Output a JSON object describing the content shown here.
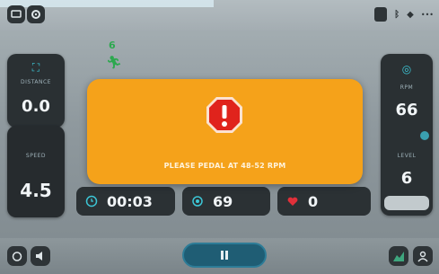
{
  "left_panel": {
    "distance_label": "DISTANCE",
    "distance_value": "0.0",
    "speed_label": "SPEED",
    "speed_value": "4.5"
  },
  "right_panel": {
    "rpm_label": "RPM",
    "rpm_value": "66",
    "level_label": "LEVEL",
    "level_value": "6"
  },
  "activity": {
    "count": "6"
  },
  "stats": {
    "time": "00:03",
    "center_value": "69",
    "heart_value": "0"
  },
  "alert": {
    "message": "PLEASE PEDAL AT 48-52 RPM"
  },
  "colors": {
    "alert_bg": "#f5a21a",
    "alert_icon": "#e0231c",
    "accent_cyan": "#3cc6d6",
    "heart_red": "#e0303a"
  },
  "icons": {
    "top_left": [
      "screen-icon",
      "gear-icon"
    ],
    "top_right": [
      "tablet-icon",
      "bluetooth-icon",
      "wifi-icon",
      "more-icon"
    ],
    "bottom_left": [
      "alarm-icon",
      "volume-icon"
    ],
    "bottom_right": [
      "chart-icon",
      "user-icon"
    ]
  }
}
